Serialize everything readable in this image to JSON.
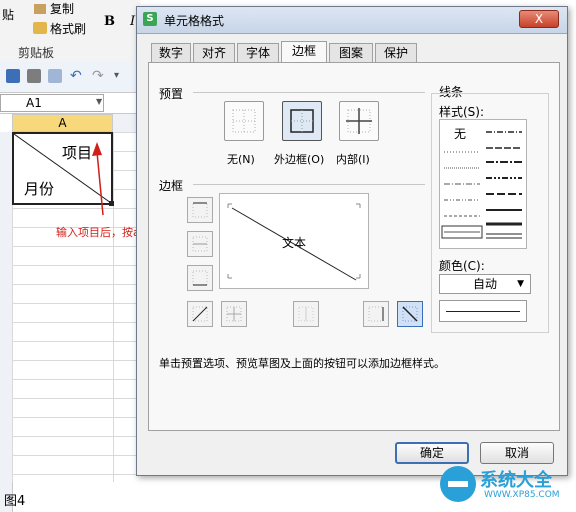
{
  "ribbon": {
    "paste_partial": "贴",
    "copy_partial": "复制",
    "format_painter": "格式刷",
    "bold": "B",
    "clipboard_group": "剪贴板"
  },
  "formula_bar": {
    "cell_ref": "A1"
  },
  "sheet": {
    "col_a": "A",
    "cell_top_right_text": "项目",
    "cell_bottom_left_text": "月份"
  },
  "annotation": {
    "text": "输入项目后，按alt+回车换行",
    "color": "#d0201a"
  },
  "dialog": {
    "title": "单元格格式",
    "close_label": "X",
    "tabs": [
      "数字",
      "对齐",
      "字体",
      "边框",
      "图案",
      "保护"
    ],
    "active_tab": "边框",
    "presets": {
      "label": "预置",
      "none": "无(N)",
      "outline": "外边框(O)",
      "inside": "内部(I)"
    },
    "border": {
      "label": "边框",
      "preview_text": "文本"
    },
    "line": {
      "label": "线条",
      "style_label": "样式(S):",
      "none": "无",
      "color_label": "颜色(C):",
      "color_value": "自动"
    },
    "hint": "单击预置选项、预览草图及上面的按钮可以添加边框样式。",
    "ok": "确定",
    "cancel": "取消"
  },
  "watermark": {
    "brand": "系统大全",
    "url": "WWW.XP85.COM"
  },
  "caption": "图4",
  "colors": {
    "accent": "#3b6fb6",
    "brand": "#2aa0d8"
  }
}
